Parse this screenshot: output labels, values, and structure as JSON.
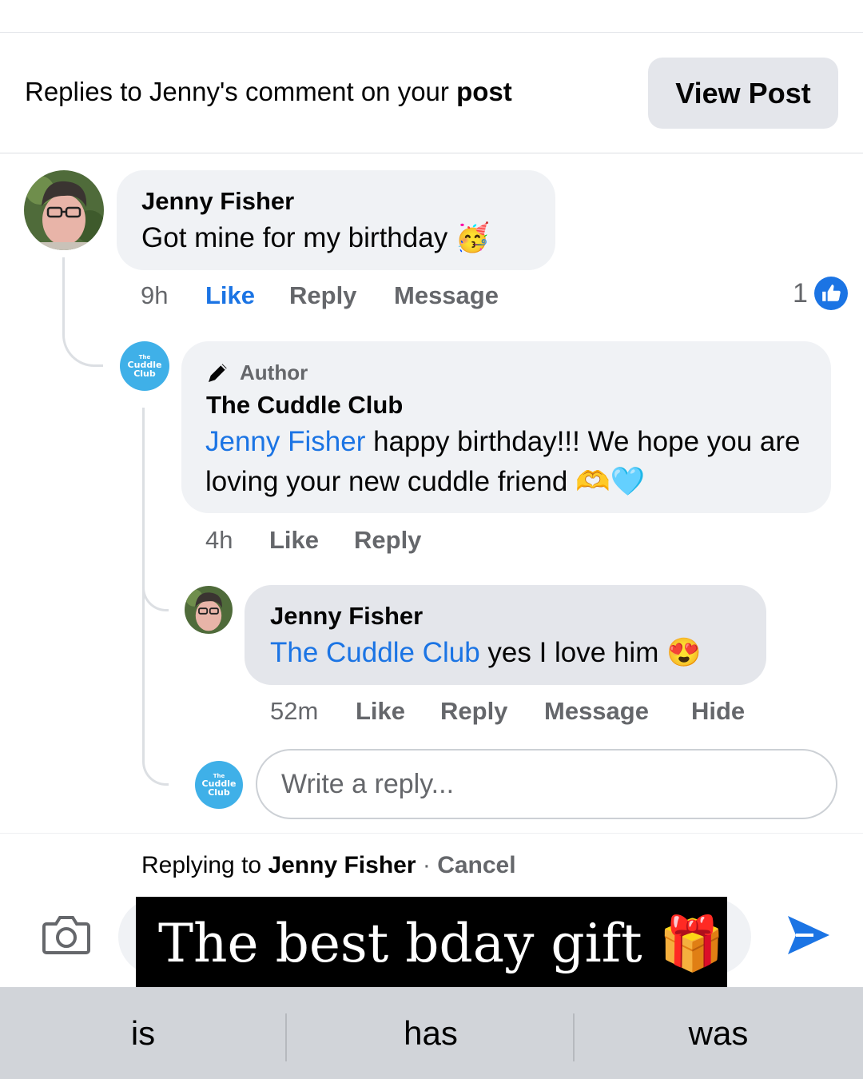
{
  "header": {
    "text_prefix": "Replies to Jenny's comment on your ",
    "text_bold": "post",
    "view_post_label": "View Post"
  },
  "comments": [
    {
      "author": "Jenny Fisher",
      "text": "Got mine for my birthday 🥳",
      "time": "9h",
      "actions": [
        "Like",
        "Reply",
        "Message"
      ],
      "reaction_count": "1"
    },
    {
      "badge": "Author",
      "author": "The Cuddle Club",
      "mention": "Jenny Fisher",
      "text": " happy birthday!!! We hope you are loving your new cuddle friend 🫶🩵",
      "time": "4h",
      "actions": [
        "Like",
        "Reply"
      ]
    },
    {
      "author": "Jenny Fisher",
      "mention": "The Cuddle Club",
      "text": " yes I love him 😍",
      "time": "52m",
      "actions": [
        "Like",
        "Reply",
        "Message",
        "Hide"
      ]
    }
  ],
  "reply_box": {
    "placeholder": "Write a reply..."
  },
  "composer": {
    "replying_prefix": "Replying to ",
    "replying_name": "Jenny Fisher",
    "separator": " · ",
    "cancel_label": "Cancel"
  },
  "caption": "The best bday gift 🎁",
  "keyboard_suggestions": [
    "is",
    "has",
    "was"
  ],
  "avatar_logo_text": [
    "The",
    "Cuddle",
    "Club"
  ],
  "colors": {
    "accent_blue": "#1b74e4",
    "brand_cyan": "#3fb0e8",
    "bubble": "#f0f2f5"
  },
  "icons": {
    "camera": "camera-icon",
    "send": "send-icon",
    "like_reaction": "like-reaction-icon",
    "author_badge": "pen-icon"
  }
}
